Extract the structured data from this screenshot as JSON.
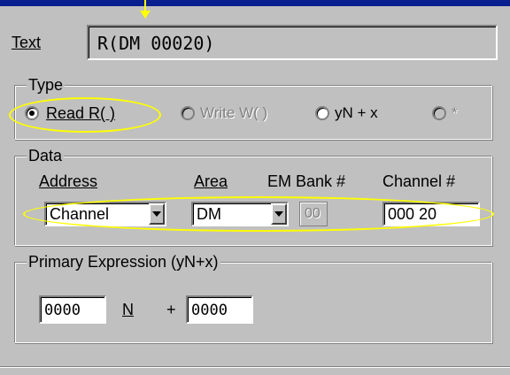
{
  "text_field": {
    "label": "Text",
    "value": "R(DM 00020)"
  },
  "type_group": {
    "legend": "Type",
    "options": [
      {
        "label": "Read R( )",
        "selected": true,
        "enabled": true
      },
      {
        "label": "Write W( )",
        "selected": false,
        "enabled": false
      },
      {
        "label": "yN + x",
        "selected": false,
        "enabled": true
      },
      {
        "label": "*",
        "selected": false,
        "enabled": false
      }
    ]
  },
  "data_group": {
    "legend": "Data",
    "address_label": "Address",
    "area_label": "Area",
    "em_bank_label": "EM Bank #",
    "channel_label": "Channel #",
    "address_value": "Channel",
    "area_value": "DM",
    "em_bank_value": "00",
    "channel_value": "000 20"
  },
  "primary_group": {
    "legend": "Primary Expression (yN+x)",
    "n_value": "0000",
    "n_label": "N",
    "plus": "+",
    "x_value": "0000"
  },
  "colors": {
    "title_bar": "#0a1f8f",
    "highlight": "#ffff00",
    "face": "#c0c0c0"
  }
}
